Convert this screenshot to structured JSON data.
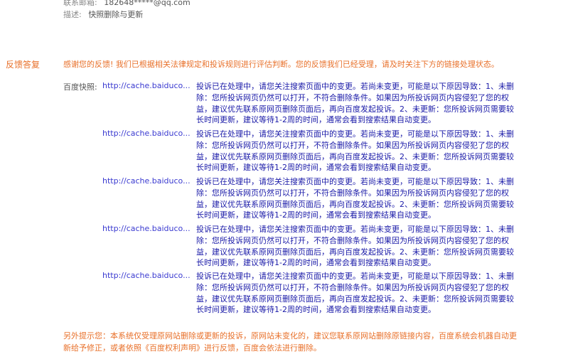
{
  "header": {
    "contact_label": "联系邮箱:",
    "contact_value": "182648*****@qq.com",
    "desc_label": "描述:",
    "desc_value": "快照删除与更新"
  },
  "feedback": {
    "title": "反馈答复",
    "message": "感谢您的反馈! 我们已根据相关法律规定和投诉规则进行评估判断。您的反馈我们已经受理，请及时关注下方的链接处理状态。"
  },
  "snapshots": {
    "label": "百度快照:",
    "items": [
      {
        "link": "http://cache.baiduco...",
        "text": "投诉已在处理中，请您关注搜索页面中的变更。若尚未变更，可能是以下原因导致：1、未删除：您所投诉网页仍然可以打开，不符合删除条件。如果因为所投诉网页内容侵犯了您的权益，建议优先联系原网页删除页面后，再向百度发起投诉。2、未更新：您所投诉网页需要较长时间更新，建议等待1-2周的时间，通常会看到搜索结果自动变更。"
      },
      {
        "link": "http://cache.baiduco...",
        "text": "投诉已在处理中，请您关注搜索页面中的变更。若尚未变更，可能是以下原因导致：1、未删除：您所投诉网页仍然可以打开，不符合删除条件。如果因为所投诉网页内容侵犯了您的权益，建议优先联系原网页删除页面后，再向百度发起投诉。2、未更新：您所投诉网页需要较长时间更新，建议等待1-2周的时间，通常会看到搜索结果自动变更。"
      },
      {
        "link": "http://cache.baiduco...",
        "text": "投诉已在处理中，请您关注搜索页面中的变更。若尚未变更，可能是以下原因导致：1、未删除：您所投诉网页仍然可以打开，不符合删除条件。如果因为所投诉网页内容侵犯了您的权益，建议优先联系原网页删除页面后，再向百度发起投诉。2、未更新：您所投诉网页需要较长时间更新，建议等待1-2周的时间，通常会看到搜索结果自动变更。"
      },
      {
        "link": "http://cache.baiduco...",
        "text": "投诉已在处理中，请您关注搜索页面中的变更。若尚未变更，可能是以下原因导致：1、未删除：您所投诉网页仍然可以打开，不符合删除条件。如果因为所投诉网页内容侵犯了您的权益，建议优先联系原网页删除页面后，再向百度发起投诉。2、未更新：您所投诉网页需要较长时间更新，建议等待1-2周的时间，通常会看到搜索结果自动变更。"
      },
      {
        "link": "http://cache.baiduco...",
        "text": "投诉已在处理中，请您关注搜索页面中的变更。若尚未变更，可能是以下原因导致：1、未删除：您所投诉网页仍然可以打开，不符合删除条件。如果因为所投诉网页内容侵犯了您的权益，建议优先联系原网页删除页面后，再向百度发起投诉。2、未更新：您所投诉网页需要较长时间更新，建议等待1-2周的时间，通常会看到搜索结果自动变更。"
      }
    ]
  },
  "note": "另外提示您：本系统仅受理原网站删除或更新的投诉，原网站未变化的，建议您联系原网站删除原链接内容，百度系统会机器自动更新给予修正，或者依照《百度权利声明》进行反馈，百度会依法进行删除。"
}
